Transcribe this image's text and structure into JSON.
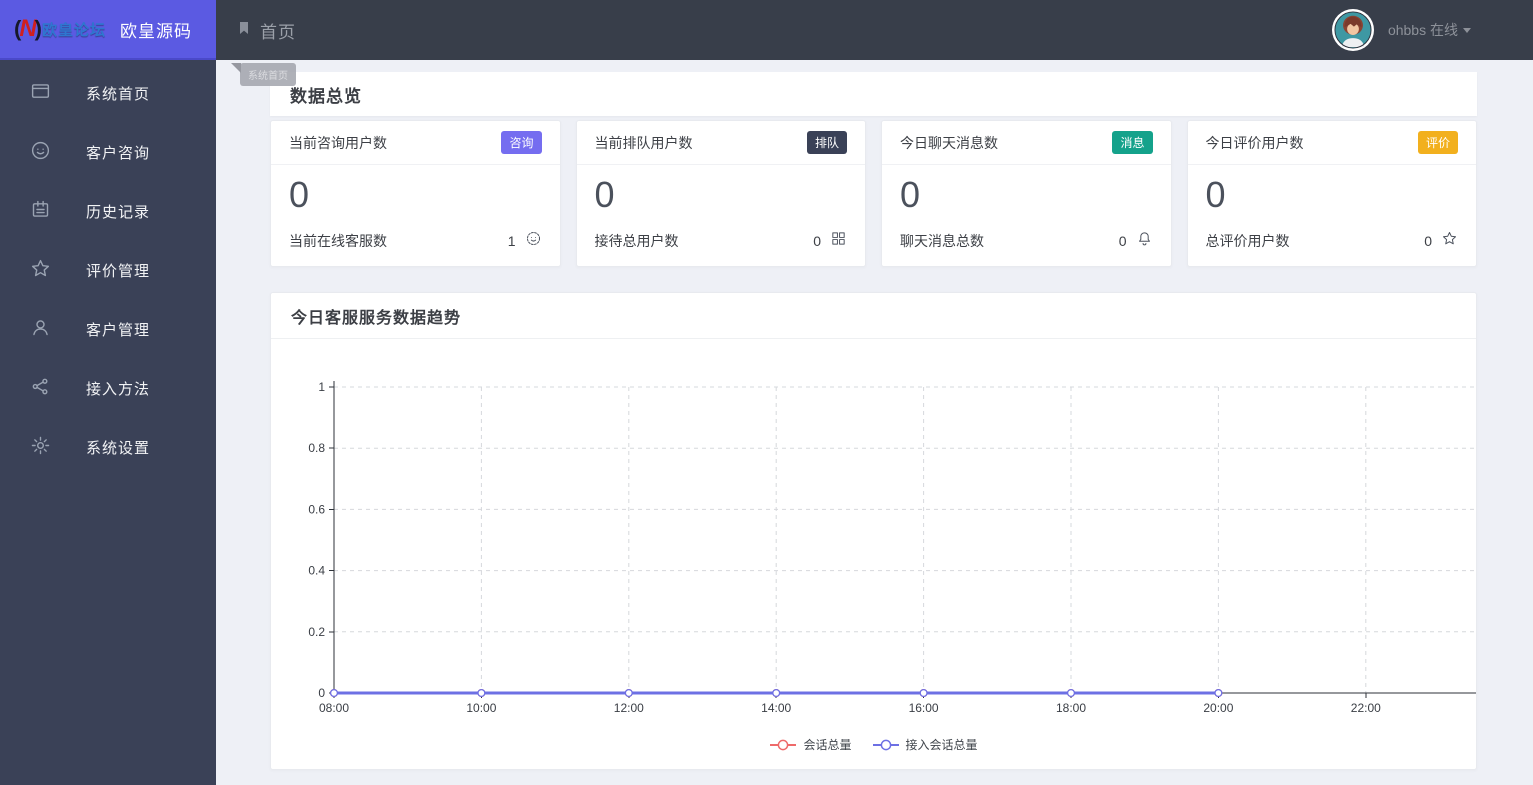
{
  "brand": {
    "logo_mark_left": "(",
    "logo_mark_letter": "N",
    "logo_mark_right": ")",
    "logo_subtitle": "欧皇论坛",
    "app_title": "欧皇源码"
  },
  "topbar": {
    "tab_label": "首页",
    "ghost_tab": "系统首页",
    "username": "ohbbs 在线"
  },
  "sidebar": {
    "items": [
      {
        "icon": "monitor-icon",
        "label": "系统首页"
      },
      {
        "icon": "smiley-icon",
        "label": "客户咨询"
      },
      {
        "icon": "notebook-icon",
        "label": "历史记录"
      },
      {
        "icon": "star-icon",
        "label": "评价管理"
      },
      {
        "icon": "user-icon",
        "label": "客户管理"
      },
      {
        "icon": "link-icon",
        "label": "接入方法"
      },
      {
        "icon": "gear-icon",
        "label": "系统设置"
      }
    ]
  },
  "overview": {
    "title": "数据总览",
    "cards": [
      {
        "title": "当前咨询用户数",
        "badge": "咨询",
        "badge_color": "#756df0",
        "value": "0",
        "footer_label": "当前在线客服数",
        "footer_value": "1",
        "footer_icon": "smiley-icon"
      },
      {
        "title": "当前排队用户数",
        "badge": "排队",
        "badge_color": "#3a4157",
        "value": "0",
        "footer_label": "接待总用户数",
        "footer_value": "0",
        "footer_icon": "grid-icon"
      },
      {
        "title": "今日聊天消息数",
        "badge": "消息",
        "badge_color": "#14a28b",
        "value": "0",
        "footer_label": "聊天消息总数",
        "footer_value": "0",
        "footer_icon": "bell-icon"
      },
      {
        "title": "今日评价用户数",
        "badge": "评价",
        "badge_color": "#f2b01e",
        "value": "0",
        "footer_label": "总评价用户数",
        "footer_value": "0",
        "footer_icon": "star-icon"
      }
    ]
  },
  "chart_card": {
    "title": "今日客服服务数据趋势"
  },
  "chart_data": {
    "type": "line",
    "title": "今日客服服务数据趋势",
    "x_labels": [
      "08:00",
      "10:00",
      "12:00",
      "14:00",
      "16:00",
      "18:00",
      "20:00",
      "22:00"
    ],
    "yticks": [
      0,
      0.2,
      0.4,
      0.6,
      0.8,
      1
    ],
    "ylim": [
      0,
      1
    ],
    "grid": "dashed",
    "legend_position": "bottom",
    "series": [
      {
        "name": "会话总量",
        "color": "#ee6a6a",
        "values": [
          0,
          0,
          0,
          0,
          0,
          0,
          0,
          null
        ]
      },
      {
        "name": "接入会话总量",
        "color": "#6d70e4",
        "values": [
          0,
          0,
          0,
          0,
          0,
          0,
          0,
          null
        ]
      }
    ]
  }
}
